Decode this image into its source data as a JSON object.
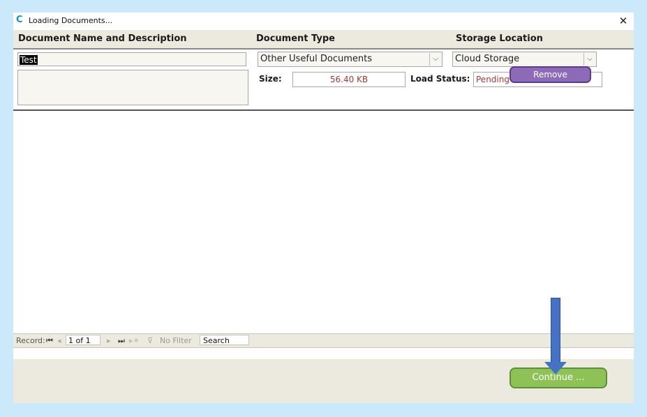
{
  "window": {
    "title": "Loading Documents..."
  },
  "headers": {
    "name_desc": "Document Name and Description",
    "doc_type": "Document Type",
    "storage": "Storage Location"
  },
  "document": {
    "name": "Test",
    "description": "",
    "doc_type": "Other Useful Documents",
    "storage_location": "Cloud Storage",
    "size_label": "Size:",
    "size": "56.40 KB",
    "load_status_label": "Load Status:",
    "load_status": "Pending",
    "remove_label": "Remove"
  },
  "navigator": {
    "record_label": "Record:",
    "record_position": "1 of 1",
    "filter_label": "No Filter",
    "search_placeholder": "Search"
  },
  "footer": {
    "continue_label": "Continue ..."
  },
  "colors": {
    "remove_button": "#8e6bb8",
    "continue_button": "#8ec257",
    "arrow": "#4472c4",
    "status_text": "#a23a3a"
  },
  "icons": {
    "app": "app-logo-icon",
    "close": "close-icon",
    "dropdown": "chevron-down-icon",
    "annotation": "down-arrow-icon"
  }
}
